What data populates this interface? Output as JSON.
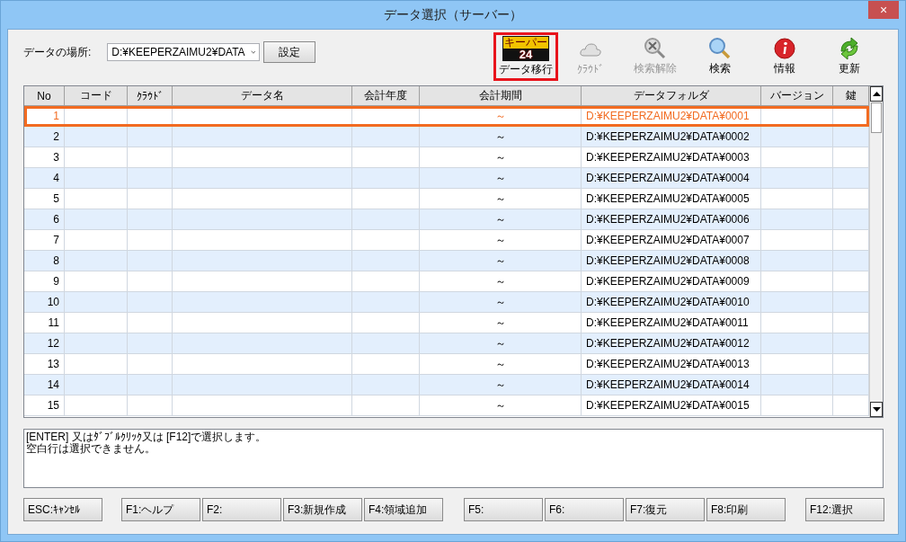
{
  "window": {
    "title": "データ選択（サーバー）",
    "close": "×"
  },
  "location": {
    "label": "データの場所:",
    "value": "D:¥KEEPERZAIMU2¥DATA",
    "button": "設定"
  },
  "toolbar": [
    {
      "kind": "logo",
      "label": "データ移行",
      "disabled": false,
      "highlighted": true,
      "logo_top": "キーパー",
      "logo_number": "24"
    },
    {
      "kind": "cloud",
      "label": "ｸﾗｳﾄﾞ",
      "disabled": true,
      "highlighted": false
    },
    {
      "kind": "search-clear",
      "label": "検索解除",
      "disabled": true,
      "highlighted": false
    },
    {
      "kind": "search",
      "label": "検索",
      "disabled": false,
      "highlighted": false
    },
    {
      "kind": "info",
      "label": "情報",
      "disabled": false,
      "highlighted": false
    },
    {
      "kind": "refresh",
      "label": "更新",
      "disabled": false,
      "highlighted": false
    }
  ],
  "table": {
    "columns": [
      "No",
      "コード",
      "ｸﾗｳﾄﾞ",
      "データ名",
      "会計年度",
      "会計期間",
      "データフォルダ",
      "バージョン",
      "鍵"
    ],
    "rows": [
      {
        "no": "1",
        "period": "～",
        "folder": "D:¥KEEPERZAIMU2¥DATA¥0001",
        "selected": true
      },
      {
        "no": "2",
        "period": "～",
        "folder": "D:¥KEEPERZAIMU2¥DATA¥0002",
        "selected": false
      },
      {
        "no": "3",
        "period": "～",
        "folder": "D:¥KEEPERZAIMU2¥DATA¥0003",
        "selected": false
      },
      {
        "no": "4",
        "period": "～",
        "folder": "D:¥KEEPERZAIMU2¥DATA¥0004",
        "selected": false
      },
      {
        "no": "5",
        "period": "～",
        "folder": "D:¥KEEPERZAIMU2¥DATA¥0005",
        "selected": false
      },
      {
        "no": "6",
        "period": "～",
        "folder": "D:¥KEEPERZAIMU2¥DATA¥0006",
        "selected": false
      },
      {
        "no": "7",
        "period": "～",
        "folder": "D:¥KEEPERZAIMU2¥DATA¥0007",
        "selected": false
      },
      {
        "no": "8",
        "period": "～",
        "folder": "D:¥KEEPERZAIMU2¥DATA¥0008",
        "selected": false
      },
      {
        "no": "9",
        "period": "～",
        "folder": "D:¥KEEPERZAIMU2¥DATA¥0009",
        "selected": false
      },
      {
        "no": "10",
        "period": "～",
        "folder": "D:¥KEEPERZAIMU2¥DATA¥0010",
        "selected": false
      },
      {
        "no": "11",
        "period": "～",
        "folder": "D:¥KEEPERZAIMU2¥DATA¥0011",
        "selected": false
      },
      {
        "no": "12",
        "period": "～",
        "folder": "D:¥KEEPERZAIMU2¥DATA¥0012",
        "selected": false
      },
      {
        "no": "13",
        "period": "～",
        "folder": "D:¥KEEPERZAIMU2¥DATA¥0013",
        "selected": false
      },
      {
        "no": "14",
        "period": "～",
        "folder": "D:¥KEEPERZAIMU2¥DATA¥0014",
        "selected": false
      },
      {
        "no": "15",
        "period": "～",
        "folder": "D:¥KEEPERZAIMU2¥DATA¥0015",
        "selected": false
      }
    ]
  },
  "help_text": [
    "[ENTER] 又はﾀﾞﾌﾞﾙｸﾘｯｸ又は [F12]で選択します。",
    "空白行は選択できません。"
  ],
  "function_keys": [
    [
      "ESC:ｷｬﾝｾﾙ"
    ],
    [
      "F1:ヘルプ",
      "F2:",
      "F3:新規作成",
      "F4:領域追加"
    ],
    [
      "F5:",
      "F6:",
      "F7:復元",
      "F8:印刷"
    ],
    [
      "F12:選択"
    ]
  ]
}
